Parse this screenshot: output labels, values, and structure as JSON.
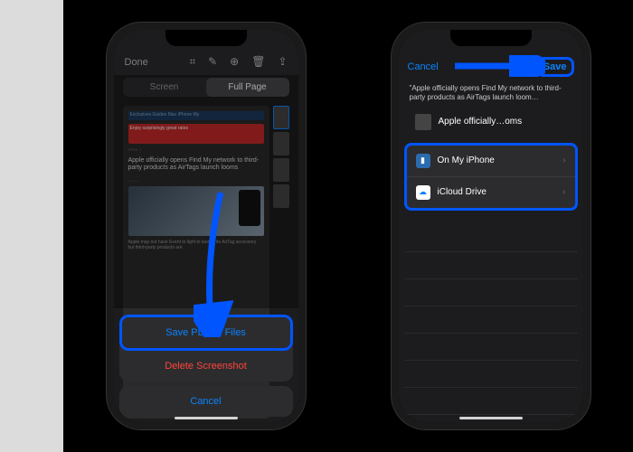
{
  "phone1": {
    "done_label": "Done",
    "tabs": {
      "screen": "Screen",
      "full_page": "Full Page"
    },
    "article": {
      "nav": "Exclusives  Guides  Mac  iPhone  My",
      "banner": "Enjoy surprisingly great rates",
      "date": "APRIL 7",
      "title": "Apple officially opens Find My network to third-party products as AirTags launch looms",
      "sub": "Apple may not have Event to light to launch its AirTag accessory but third-party products are"
    },
    "sheet": {
      "save_pdf": "Save PDF to Files",
      "delete": "Delete Screenshot",
      "cancel": "Cancel"
    }
  },
  "phone2": {
    "cancel_label": "Cancel",
    "save_label": "Save",
    "description": "\"Apple officially opens Find My network to third-party products as AirTags launch loom…",
    "filename": "Apple officially…oms",
    "locations": {
      "on_my_iphone": "On My iPhone",
      "icloud_drive": "iCloud Drive"
    }
  },
  "annotation": {
    "highlight_color": "#0055ff"
  }
}
